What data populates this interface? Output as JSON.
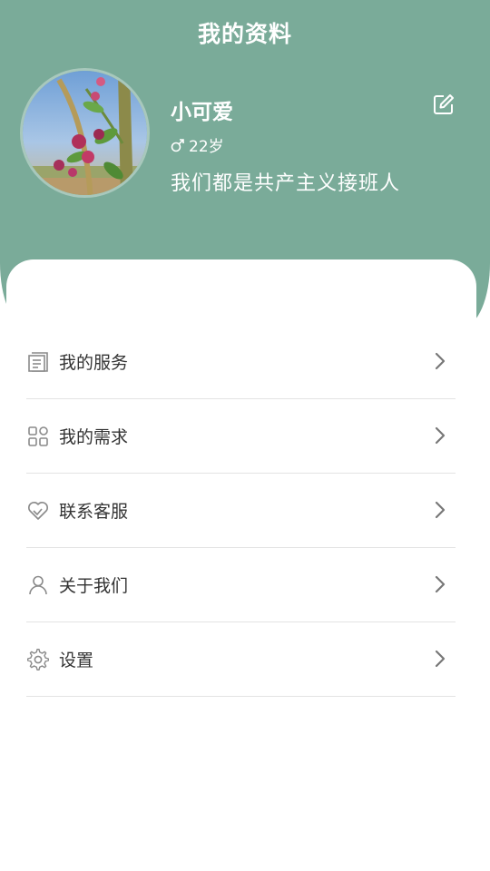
{
  "header": {
    "title": "我的资料"
  },
  "profile": {
    "name": "小可爱",
    "gender_icon": "male-icon",
    "age": "22岁",
    "signature": "我们都是共产主义接班人",
    "edit_icon": "edit-icon"
  },
  "menu": {
    "items": [
      {
        "label": "我的服务",
        "icon": "document-list-icon"
      },
      {
        "label": "我的需求",
        "icon": "grid-icon"
      },
      {
        "label": "联系客服",
        "icon": "heart-handshake-icon"
      },
      {
        "label": "关于我们",
        "icon": "user-icon"
      },
      {
        "label": "设置",
        "icon": "gear-icon"
      }
    ]
  },
  "colors": {
    "header_bg": "#7aab99",
    "text_primary": "#333333",
    "icon_gray": "#8a8a8a",
    "divider": "#e3e3e3"
  }
}
